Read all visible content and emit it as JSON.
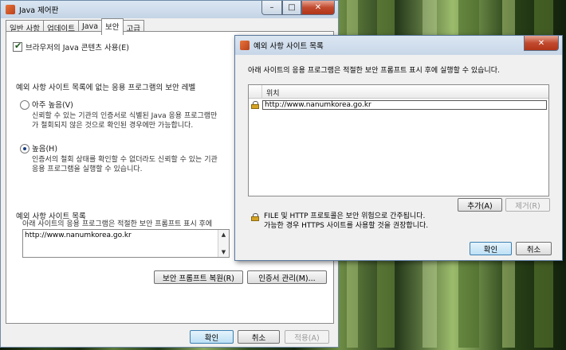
{
  "main_window": {
    "title": "Java 제어판",
    "tabs": [
      "일반 사항",
      "업데이트",
      "Java",
      "보안",
      "고급"
    ],
    "enable_java_checkbox": "브라우저의 Java 콘텐츠 사용(E)",
    "security_level_heading": "예외 사항 사이트 목록에 없는 응용 프로그램의 보안 레벨",
    "very_high": {
      "label": "아주 높음(V)",
      "desc_line1": "신뢰할 수 있는 기관의 인증서로 식별된 Java 응용 프로그램만",
      "desc_line2": "가 철회되지 않은 것으로 확인된 경우에만 가능합니다."
    },
    "high": {
      "label": "높음(H)",
      "desc_line1": "인증서의 철회 상태를 확인할 수 없더라도 신뢰할 수 있는 기관",
      "desc_line2": "응용 프로그램을 실행할 수 있습니다."
    },
    "exception_heading": "예외 사항 사이트 목록",
    "exception_desc": "아래 사이트의 응용 프로그램은 적절한 보안 프롬프트 표시 후에",
    "exception_site": "http://www.nanumkorea.go.kr",
    "restore_prompts_button": "보안 프롬프트 복원(R)",
    "manage_certs_button": "인증서 관리(M)...",
    "ok_button": "확인",
    "cancel_button": "취소",
    "apply_button": "적용(A)"
  },
  "dialog": {
    "title": "예외 사항 사이트 목록",
    "description": "아래 사이트의 응용 프로그램은 적절한 보안 프롬프트 표시 후에 실행할 수 있습니다.",
    "column_header": "위치",
    "rows": [
      "http://www.nanumkorea.go.kr"
    ],
    "add_button": "추가(A)",
    "remove_button": "제거(R)",
    "warning_line1": "FILE 및 HTTP 프로토콜은 보안 위험으로 간주됩니다.",
    "warning_line2": "가능한 경우 HTTPS 사이트를 사용할 것을 권장합니다.",
    "ok_button": "확인",
    "cancel_button": "취소"
  },
  "icons": {
    "java": "java-coffee-icon",
    "lock": "lock-icon",
    "close": "close-icon"
  }
}
